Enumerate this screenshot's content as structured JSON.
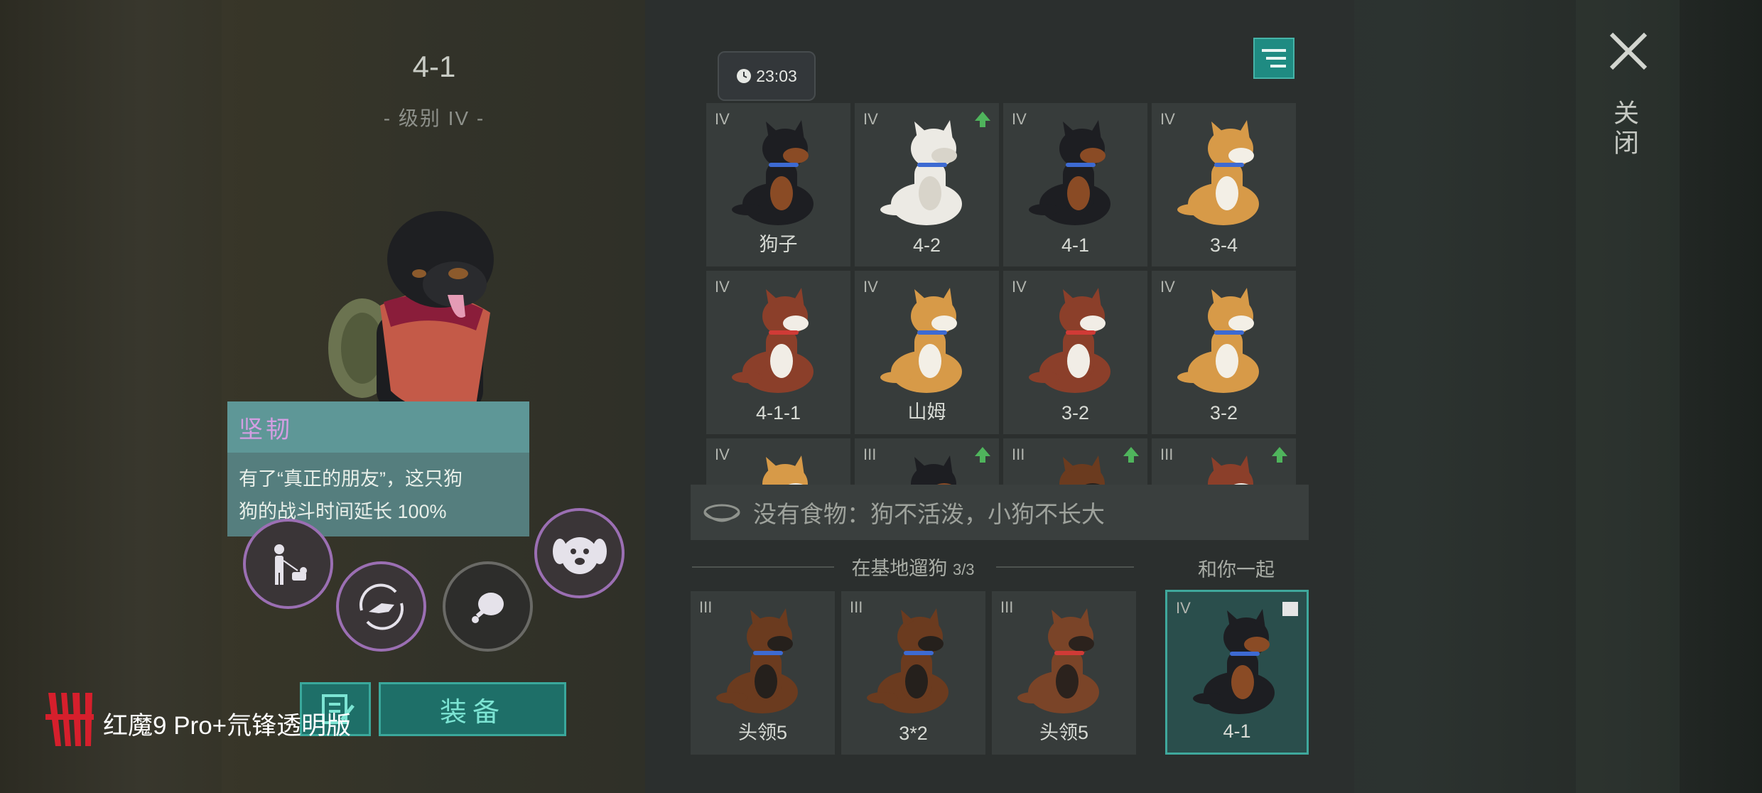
{
  "header": {
    "dog_name": "4-1",
    "dog_level": "- 级别 IV -"
  },
  "trait": {
    "name": "坚韧",
    "desc_line1": "有了“真正的朋友”，这只狗",
    "desc_line2": "狗的战斗时间延长 100%"
  },
  "actions": {
    "equip_label": "装备"
  },
  "watermark": {
    "text": "红魔9 Pro+氘锋透明版"
  },
  "timer": {
    "value": "23:03"
  },
  "dog_grid": [
    {
      "level": "IV",
      "name": "狗子",
      "breed": "rottweiler",
      "upgrade": false
    },
    {
      "level": "IV",
      "name": "4-2",
      "breed": "white-pup",
      "upgrade": true
    },
    {
      "level": "IV",
      "name": "4-1",
      "breed": "rottweiler",
      "upgrade": false
    },
    {
      "level": "IV",
      "name": "3-4",
      "breed": "shiba",
      "upgrade": false
    },
    {
      "level": "IV",
      "name": "4-1-1",
      "breed": "husky",
      "upgrade": false
    },
    {
      "level": "IV",
      "name": "山姆",
      "breed": "shiba",
      "upgrade": false
    },
    {
      "level": "IV",
      "name": "3-2",
      "breed": "husky",
      "upgrade": false
    },
    {
      "level": "IV",
      "name": "3-2",
      "breed": "shiba",
      "upgrade": false
    },
    {
      "level": "IV",
      "name": "",
      "breed": "shiba",
      "upgrade": false
    },
    {
      "level": "III",
      "name": "",
      "breed": "rottweiler",
      "upgrade": true
    },
    {
      "level": "III",
      "name": "",
      "breed": "shepherd",
      "upgrade": true
    },
    {
      "level": "III",
      "name": "",
      "breed": "husky",
      "upgrade": true
    }
  ],
  "food_status": "没有食物：狗不活泼，小狗不长大",
  "walk_section": {
    "label": "在基地遛狗",
    "count": "3/3"
  },
  "walk_dogs": [
    {
      "level": "III",
      "name": "头领5",
      "breed": "shepherd"
    },
    {
      "level": "III",
      "name": "3*2",
      "breed": "shepherd"
    },
    {
      "level": "III",
      "name": "头领5",
      "breed": "shepherd-red"
    }
  ],
  "companion": {
    "label": "和你一起",
    "level": "IV",
    "name": "4-1",
    "breed": "rottweiler"
  },
  "close": {
    "label": "关闭"
  },
  "colors": {
    "accent": "#1f8b82",
    "purple_ring": "#9b6fb3",
    "trait_title": "#d39ee2",
    "upgrade_arrow": "#4fb45c"
  }
}
